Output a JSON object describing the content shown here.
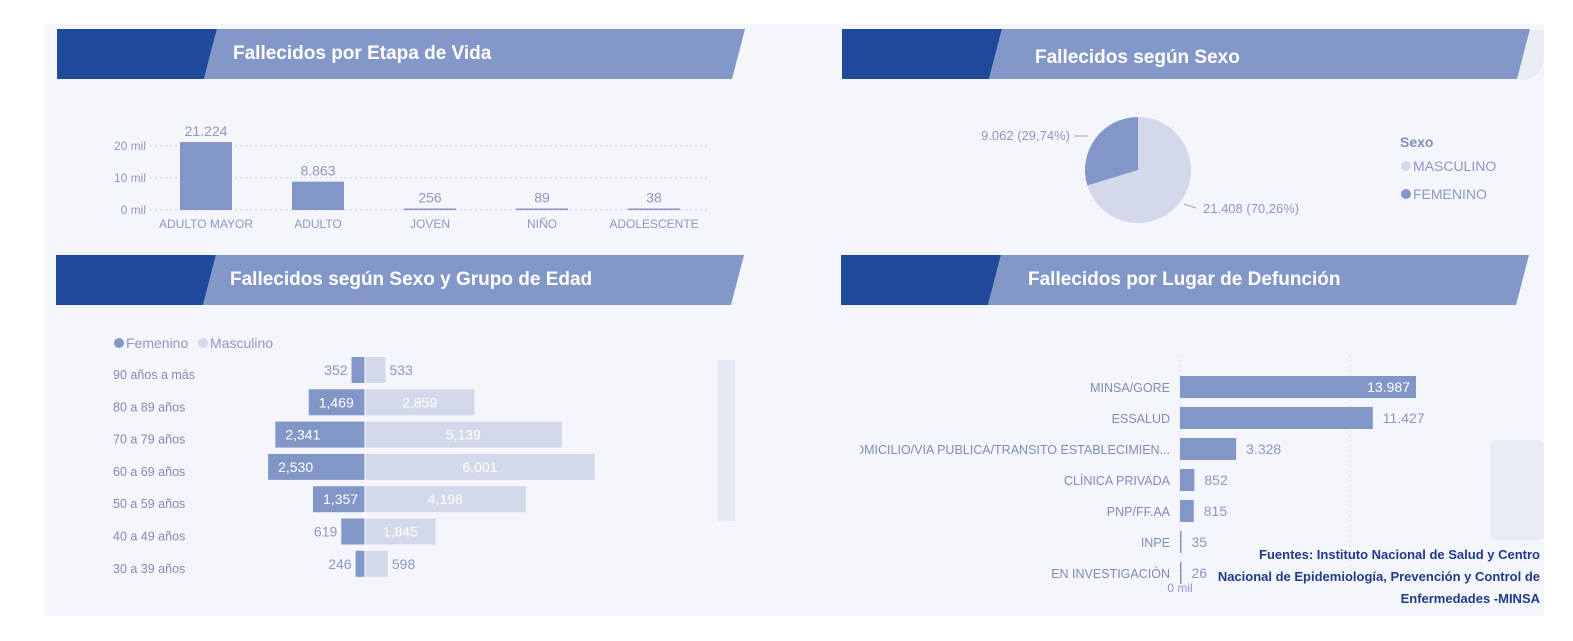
{
  "colors": {
    "banner_dark": "#1f4a9a",
    "banner_light": "#8398c8",
    "bar": "#8296c7",
    "bar_light": "#d3d9ea",
    "axis_text": "#8a99c4",
    "source_text": "#1f3a8a"
  },
  "panels": {
    "etapa": "Fallecidos por Etapa de Vida",
    "sexo": "Fallecidos según Sexo",
    "sexo_edad": "Fallecidos según Sexo y Grupo de Edad",
    "lugar": "Fallecidos por Lugar de Defunción"
  },
  "source_text": "Fuentes: Instituto Nacional de Salud y Centro Nacional de Epidemiología, Prevención y Control de Enfermedades -MINSA",
  "chart_data": [
    {
      "id": "etapa",
      "type": "bar",
      "categories": [
        "ADULTO MAYOR",
        "ADULTO",
        "JOVEN",
        "NIÑO",
        "ADOLESCENTE"
      ],
      "values": [
        21224,
        8863,
        256,
        89,
        38
      ],
      "value_labels": [
        "21.224",
        "8.863",
        "256",
        "89",
        "38"
      ],
      "yticks": [
        "0 mil",
        "10 mil",
        "20 mil"
      ],
      "ylim": [
        0,
        25000
      ],
      "grid": true
    },
    {
      "id": "sexo",
      "type": "pie",
      "legend_title": "Sexo",
      "legend_position": "right",
      "slices": [
        {
          "name": "MASCULINO",
          "value": 21408,
          "label": "21.408 (70,26%)",
          "color": "#d3d9ea"
        },
        {
          "name": "FEMENINO",
          "value": 9062,
          "label": "9.062 (29,74%)",
          "color": "#8296c7"
        }
      ]
    },
    {
      "id": "sexo_edad",
      "type": "bar",
      "orientation": "horizontal-diverging",
      "legend": [
        "Femenino",
        "Masculino"
      ],
      "legend_position": "top-left",
      "categories": [
        "90 años a más",
        "80 a 89 años",
        "70 a 79 años",
        "60 a 69 años",
        "50 a 59 años",
        "40 a 49 años",
        "30 a 39 años"
      ],
      "series": [
        {
          "name": "Femenino",
          "values": [
            352,
            1469,
            2341,
            2530,
            1357,
            619,
            246
          ],
          "value_labels": [
            "352",
            "1,469",
            "2,341",
            "2,530",
            "1,357",
            "619",
            "246"
          ]
        },
        {
          "name": "Masculino",
          "values": [
            533,
            2859,
            5139,
            6001,
            4198,
            1845,
            598
          ],
          "value_labels": [
            "533",
            "2,859",
            "5,139",
            "6,001",
            "4,198",
            "1,845",
            "598"
          ]
        }
      ]
    },
    {
      "id": "lugar",
      "type": "bar",
      "orientation": "horizontal",
      "categories": [
        "MINSA/GORE",
        "ESSALUD",
        "DOMICILIO/VIA PUBLICA/TRANSITO ESTABLECIMIEN...",
        "CLÍNICA PRIVADA",
        "PNP/FF.AA",
        "INPE",
        "EN INVESTIGACIÓN"
      ],
      "values": [
        13987,
        11427,
        3328,
        852,
        815,
        35,
        26
      ],
      "value_labels": [
        "13.987",
        "11.427",
        "3.328",
        "852",
        "815",
        "35",
        "26"
      ],
      "xticks": [
        "0 mil"
      ]
    }
  ]
}
